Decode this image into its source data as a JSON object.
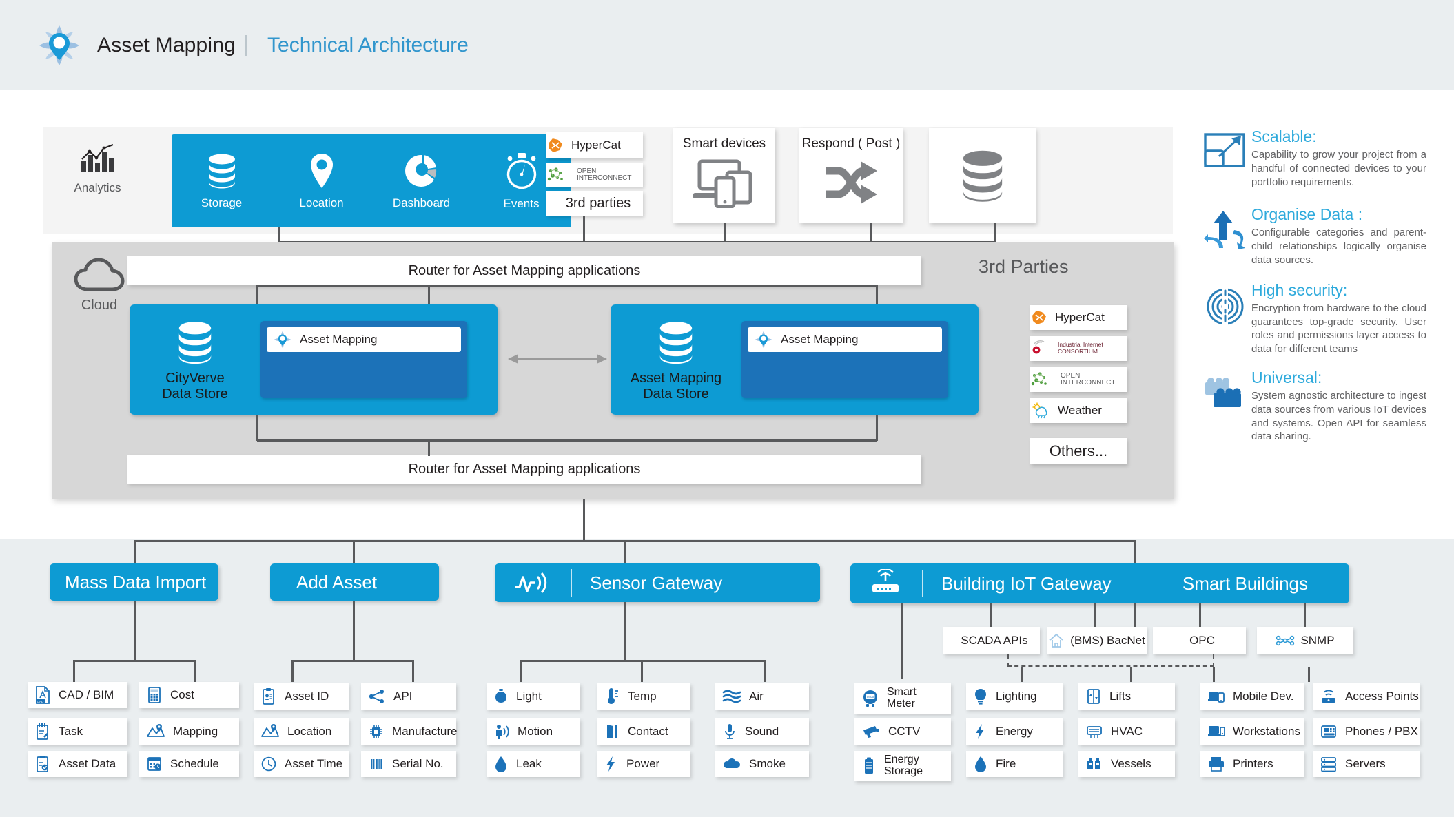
{
  "header": {
    "logo_icon": "asset-mapping-pin-logo",
    "brand": "Asset Mapping",
    "subtitle": "Technical Architecture"
  },
  "top_panel": {
    "analytics": {
      "label": "Analytics",
      "icon": "bar-chart-trend-icon"
    },
    "features": [
      {
        "label": "Storage",
        "icon": "database-icon"
      },
      {
        "label": "Location",
        "icon": "map-pin-icon"
      },
      {
        "label": "Dashboard",
        "icon": "donut-chart-icon"
      },
      {
        "label": "Events",
        "icon": "stopwatch-icon"
      }
    ],
    "chips": [
      {
        "label": "HyperCat",
        "icon": "hypercat-logo-icon"
      },
      {
        "label": "OPEN INTERCONNECT",
        "icon": "open-interconnect-logo-icon"
      },
      {
        "label": "3rd parties",
        "icon": "none"
      }
    ],
    "smart_devices": {
      "title": "Smart devices",
      "icon": "devices-icon"
    },
    "respond": {
      "title": "Respond ( Post )",
      "icon": "shuffle-arrows-icon"
    },
    "database_box": {
      "title": "",
      "icon": "database-gray-icon"
    }
  },
  "cloud_panel": {
    "cloud_label": "Cloud",
    "cloud_icon": "cloud-icon",
    "router_top": "Router for Asset Mapping applications",
    "router_bottom": "Router for Asset Mapping applications",
    "stores": [
      {
        "name": "CityVerve\nData Store",
        "icon": "database-icon",
        "inner_label": "Asset Mapping",
        "inner_icon": "asset-mapping-pin-logo"
      },
      {
        "name": "Asset Mapping\nData Store",
        "icon": "database-icon",
        "inner_label": "Asset Mapping",
        "inner_icon": "asset-mapping-pin-logo"
      }
    ],
    "third_parties": {
      "title": "3rd Parties",
      "items": [
        {
          "label": "HyperCat",
          "icon": "hypercat-logo-icon"
        },
        {
          "label": "Industrial Internet CONSORTIUM",
          "icon": "iic-logo-icon"
        },
        {
          "label": "OPEN INTERCONNECT",
          "icon": "open-interconnect-logo-icon"
        },
        {
          "label": "Weather",
          "icon": "sun-cloud-rain-icon"
        },
        {
          "label": "Others...",
          "icon": "none"
        }
      ]
    }
  },
  "sidebar": {
    "items": [
      {
        "title": "Scalable:",
        "icon": "scale-arrow-icon",
        "body": "Capability to grow your project from a handful of connected devices to your portfolio requirements."
      },
      {
        "title": "Organise Data :",
        "icon": "organise-arrows-icon",
        "body": "Configurable categories and parent-child relationships logically organise data sources."
      },
      {
        "title": "High security:",
        "icon": "fingerprint-icon",
        "body": "Encryption from hardware to the cloud guarantees top-grade security. User roles and permissions layer access to data for different teams"
      },
      {
        "title": "Universal:",
        "icon": "building-blocks-icon",
        "body": "System agnostic architecture to ingest data sources from various IoT devices and systems. Open API for seamless data sharing."
      }
    ]
  },
  "groups": [
    {
      "id": "mass-data-import",
      "title": "Mass Data Import",
      "icon": "none",
      "right_title": "",
      "columns": [
        [
          {
            "label": "CAD / BIM",
            "icon": "cad-file-icon"
          },
          {
            "label": "Task",
            "icon": "task-notepad-icon"
          },
          {
            "label": "Asset Data",
            "icon": "clipboard-check-icon"
          }
        ],
        [
          {
            "label": "Cost",
            "icon": "calculator-icon"
          },
          {
            "label": "Mapping",
            "icon": "map-pin-fold-icon"
          },
          {
            "label": "Schedule",
            "icon": "calendar-clock-icon"
          }
        ]
      ]
    },
    {
      "id": "add-asset",
      "title": "Add Asset",
      "icon": "none",
      "right_title": "",
      "columns": [
        [
          {
            "label": "Asset ID",
            "icon": "id-card-icon"
          },
          {
            "label": "Location",
            "icon": "map-pin-fold-icon"
          },
          {
            "label": "Asset Time",
            "icon": "clock-icon"
          }
        ],
        [
          {
            "label": "API",
            "icon": "share-nodes-icon"
          },
          {
            "label": "Manufacture",
            "icon": "chip-icon"
          },
          {
            "label": "Serial No.",
            "icon": "barcode-icon"
          }
        ]
      ]
    },
    {
      "id": "sensor-gateway",
      "title": "Sensor Gateway",
      "icon": "signal-wave-icon",
      "right_title": "",
      "columns": [
        [
          {
            "label": "Light",
            "icon": "bulb-icon"
          },
          {
            "label": "Motion",
            "icon": "motion-person-icon"
          },
          {
            "label": "Leak",
            "icon": "water-drop-icon"
          }
        ],
        [
          {
            "label": "Temp",
            "icon": "thermometer-icon"
          },
          {
            "label": "Contact",
            "icon": "door-icon"
          },
          {
            "label": "Power",
            "icon": "lightning-bolt-icon"
          }
        ],
        [
          {
            "label": "Air",
            "icon": "air-waves-icon"
          },
          {
            "label": "Sound",
            "icon": "microphone-icon"
          },
          {
            "label": "Smoke",
            "icon": "smoke-cloud-icon"
          }
        ]
      ]
    },
    {
      "id": "building-iot-gateway",
      "title": "Building IoT Gateway",
      "icon": "router-antenna-icon",
      "right_title": "Smart Buildings",
      "protocols": [
        {
          "label": "SCADA APIs",
          "icon": "none"
        },
        {
          "label": "(BMS) BacNet",
          "icon": "house-outline-icon"
        },
        {
          "label": "OPC",
          "icon": "none"
        },
        {
          "label": "SNMP",
          "icon": "network-nodes-icon"
        }
      ],
      "columns": [
        [
          {
            "label": "Smart\nMeter",
            "icon": "smart-meter-icon",
            "two_line": true
          },
          {
            "label": "CCTV",
            "icon": "cctv-camera-icon"
          },
          {
            "label": "Energy\nStorage",
            "icon": "battery-icon",
            "two_line": true
          }
        ],
        [
          {
            "label": "Lighting",
            "icon": "bulb-icon"
          },
          {
            "label": "Energy",
            "icon": "lightning-bolt-icon"
          },
          {
            "label": "Fire",
            "icon": "water-drop-icon"
          }
        ],
        [
          {
            "label": "Lifts",
            "icon": "lift-icon"
          },
          {
            "label": "HVAC",
            "icon": "hvac-vent-icon"
          },
          {
            "label": "Vessels",
            "icon": "vessels-icon"
          }
        ],
        [
          {
            "label": "Mobile Dev.",
            "icon": "mobile-device-icon"
          },
          {
            "label": "Workstations",
            "icon": "workstation-icon"
          },
          {
            "label": "Printers",
            "icon": "printer-icon"
          }
        ],
        [
          {
            "label": "Access Points",
            "icon": "access-point-icon"
          },
          {
            "label": "Phones / PBX",
            "icon": "phone-pbx-icon"
          },
          {
            "label": "Servers",
            "icon": "server-icon"
          }
        ]
      ]
    }
  ],
  "colors": {
    "brand_blue": "#0d9bd3",
    "accent_blue": "#2eaadc",
    "dark_blue": "#1c72b8",
    "panel_gray": "#d7d7d7",
    "band_gray": "#eaeef0",
    "text_dark": "#231f20",
    "connector": "#58595b"
  }
}
